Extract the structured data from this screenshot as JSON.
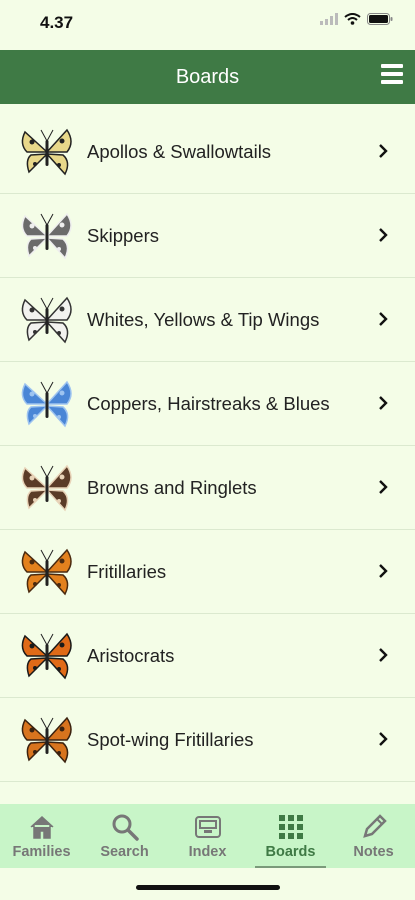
{
  "status": {
    "time": "4.37"
  },
  "header": {
    "title": "Boards"
  },
  "boards": [
    {
      "label": "Apollos & Swallowtails",
      "icon": "swallowtail-butterfly-icon"
    },
    {
      "label": "Skippers",
      "icon": "skipper-butterfly-icon"
    },
    {
      "label": "Whites, Yellows & Tip Wings",
      "icon": "white-butterfly-icon"
    },
    {
      "label": "Coppers, Hairstreaks & Blues",
      "icon": "blue-butterfly-icon"
    },
    {
      "label": "Browns and Ringlets",
      "icon": "brown-butterfly-icon"
    },
    {
      "label": "Fritillaries",
      "icon": "fritillary-butterfly-icon"
    },
    {
      "label": "Aristocrats",
      "icon": "aristocrat-butterfly-icon"
    },
    {
      "label": "Spot-wing Fritillaries",
      "icon": "spotwing-butterfly-icon"
    }
  ],
  "tabs": [
    {
      "label": "Families",
      "icon": "home-icon"
    },
    {
      "label": "Search",
      "icon": "search-icon"
    },
    {
      "label": "Index",
      "icon": "archive-box-icon"
    },
    {
      "label": "Boards",
      "icon": "grid-icon",
      "active": true
    },
    {
      "label": "Notes",
      "icon": "pencil-icon"
    }
  ],
  "colors": {
    "header": "#3f7a45",
    "background": "#f4fde7",
    "tabbar": "#c8f5c8"
  }
}
